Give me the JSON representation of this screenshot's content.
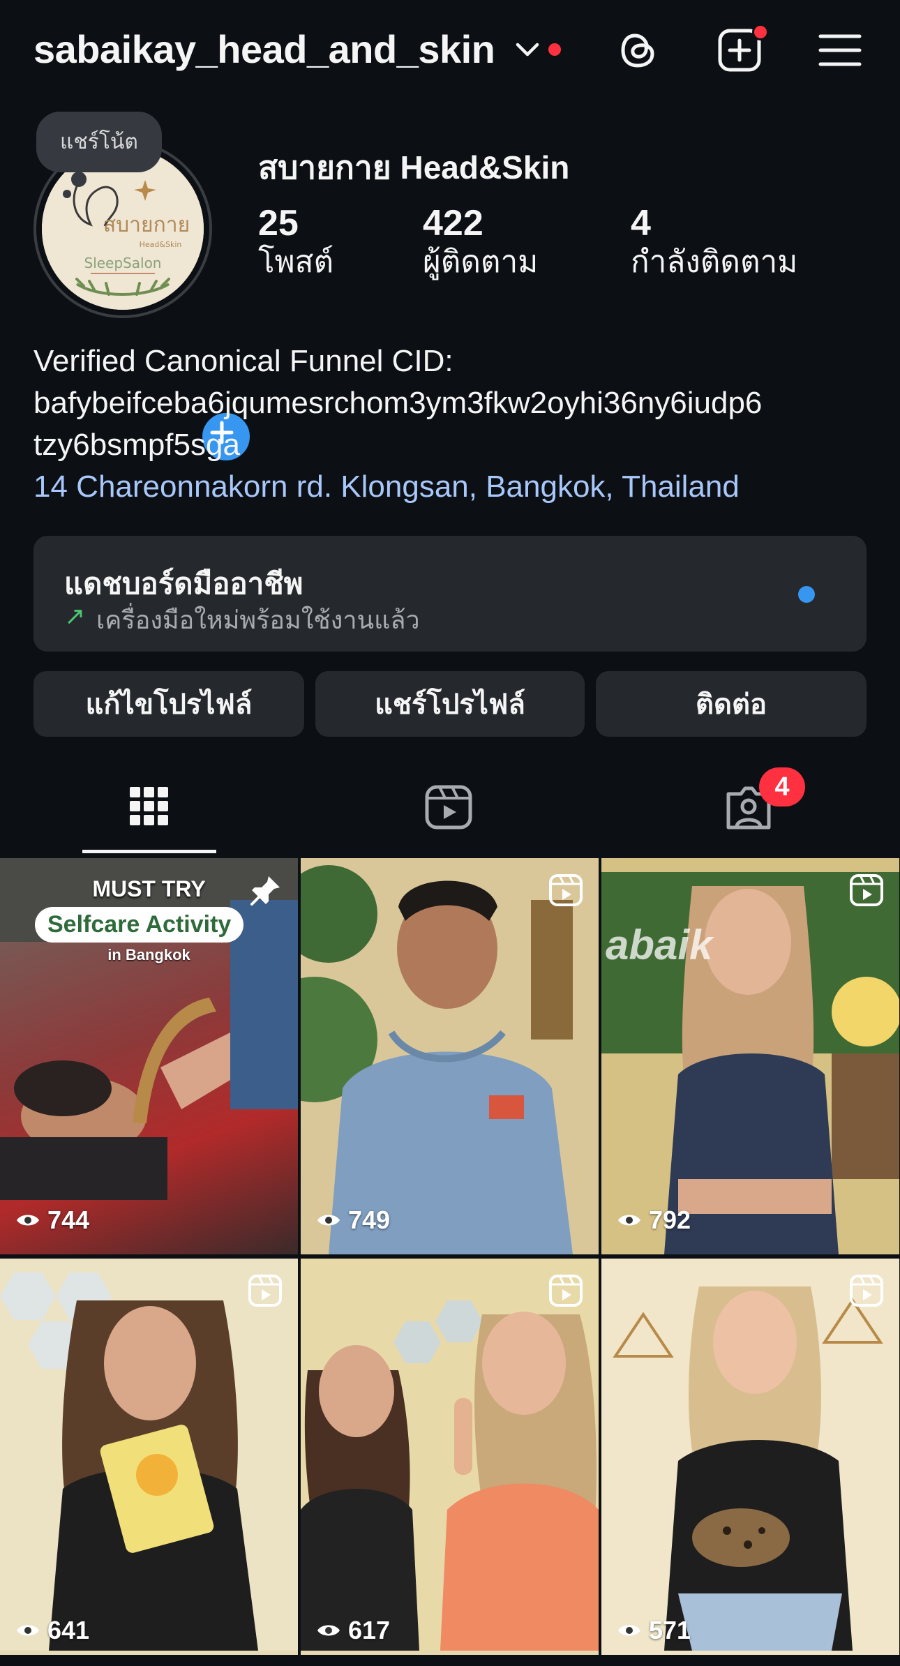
{
  "header": {
    "username": "sabaikay_head_and_skin",
    "icons": [
      "chevron-down-icon",
      "threads-icon",
      "create-post-icon",
      "menu-icon"
    ]
  },
  "profile": {
    "note": "แชร์โน้ต",
    "display_name": "สบายกาย Head&Skin",
    "avatar_text": {
      "line1": "สบายกาย",
      "line2": "Head&Skin",
      "line3": "SleepSalon"
    },
    "stats": [
      {
        "value": "25",
        "label": "โพสต์"
      },
      {
        "value": "422",
        "label": "ผู้ติดตาม"
      },
      {
        "value": "4",
        "label": "กำลังติดตาม"
      }
    ],
    "bio_lines": [
      "Verified Canonical Funnel CID:",
      "bafybeifceba6jqumesrchom3ym3fkw2oyhi36ny6iudp6",
      "tzy6bsmpf5sga"
    ],
    "location": "14 Chareonnakorn rd. Klongsan, Bangkok, Thailand"
  },
  "dashboard": {
    "title": "แดชบอร์ดมืออาชีพ",
    "subtitle": "เครื่องมือใหม่พร้อมใช้งานแล้ว"
  },
  "buttons": {
    "edit": "แก้ไขโปรไฟล์",
    "share": "แชร์โปรไฟล์",
    "contact": "ติดต่อ"
  },
  "tabs": {
    "active": "grid",
    "tagged_badge": "4",
    "icons": [
      "grid-icon",
      "reels-icon",
      "tagged-icon"
    ]
  },
  "posts": [
    {
      "views": "744",
      "type": "pinned",
      "overlay": {
        "line1": "MUST TRY",
        "line2": "Selfcare Activity",
        "line3": "in Bangkok"
      }
    },
    {
      "views": "749",
      "type": "reel"
    },
    {
      "views": "792",
      "type": "reel",
      "overlay_text": "abaik"
    },
    {
      "views": "641",
      "type": "reel"
    },
    {
      "views": "617",
      "type": "reel"
    },
    {
      "views": "571",
      "type": "reel"
    }
  ],
  "colors": {
    "background": "#0c1014",
    "accent_blue": "#3797f0",
    "badge_red": "#ff3040",
    "link": "#a8c7fa",
    "card": "#25292e"
  }
}
